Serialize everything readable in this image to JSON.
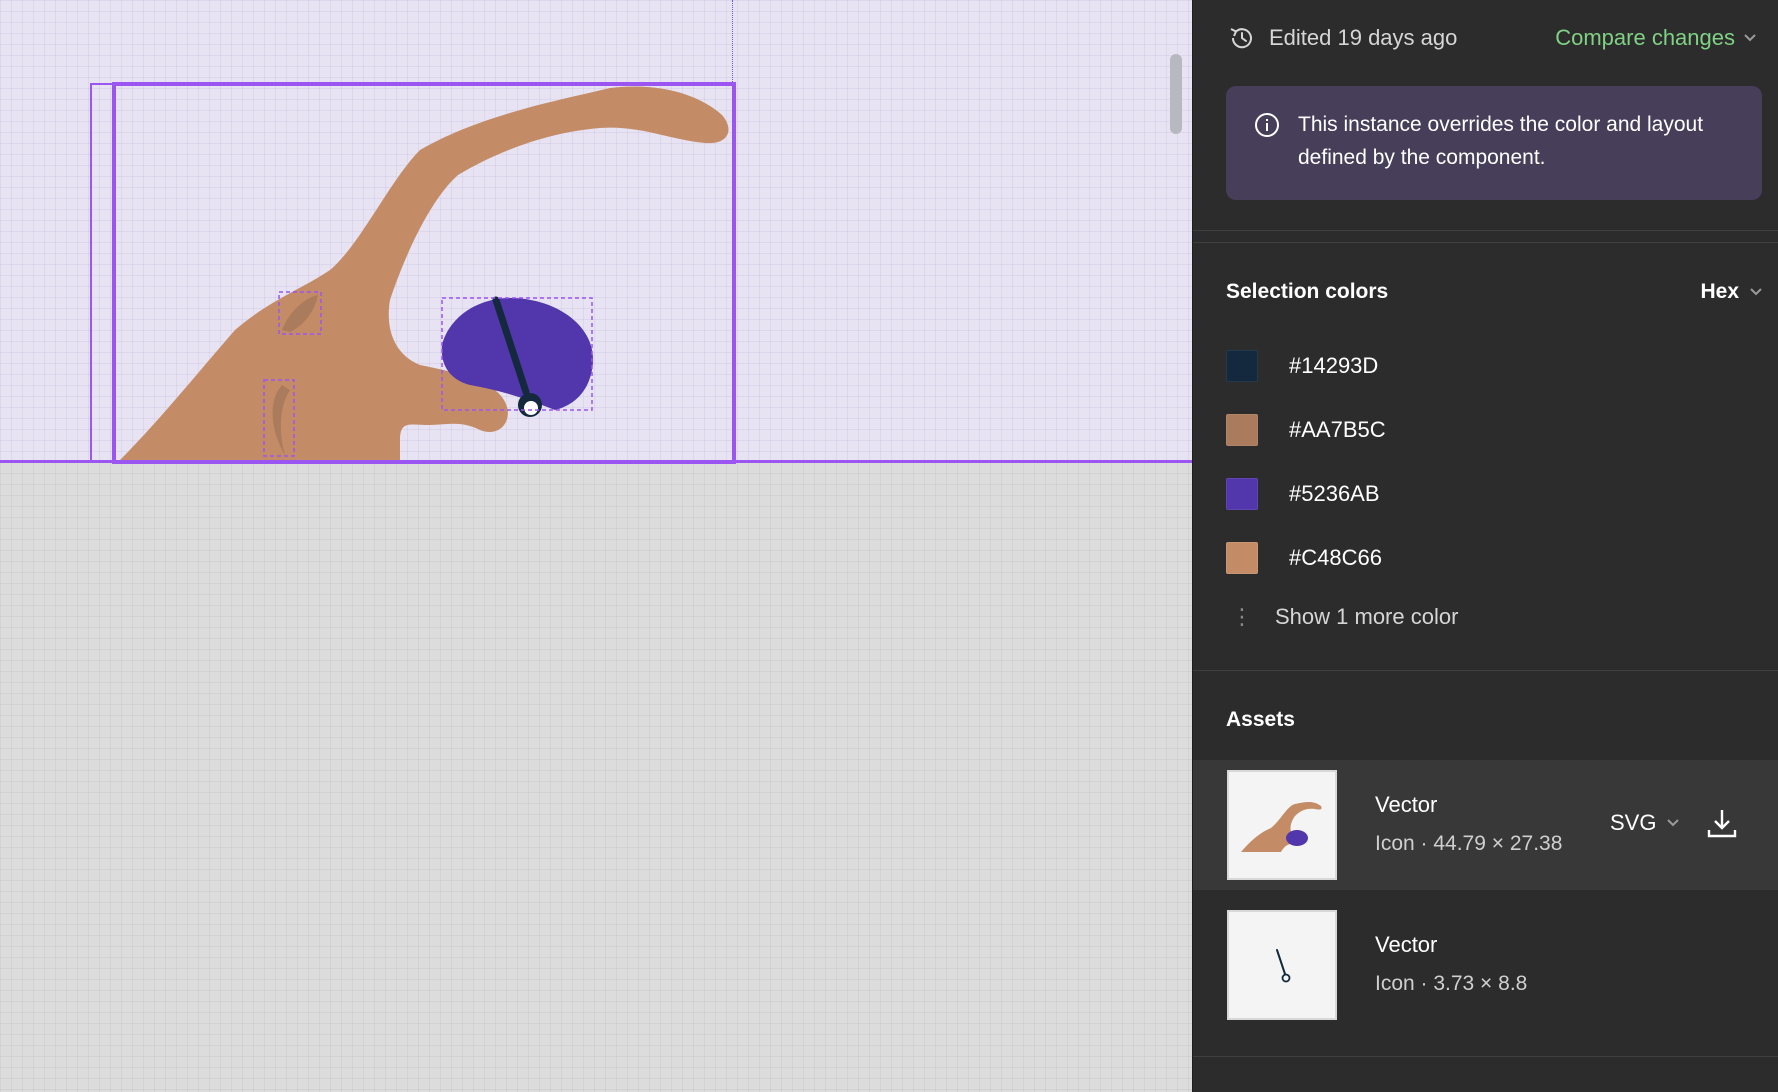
{
  "header": {
    "edited_text": "Edited 19 days ago",
    "compare_label": "Compare changes"
  },
  "notice": {
    "text": "This instance overrides the color and layout defined by the component."
  },
  "selection_colors": {
    "title": "Selection colors",
    "format": "Hex",
    "colors": [
      {
        "label": "#14293D",
        "hex": "#14293D"
      },
      {
        "label": "#AA7B5C",
        "hex": "#AA7B5C"
      },
      {
        "label": "#5236AB",
        "hex": "#5236AB"
      },
      {
        "label": "#C48C66",
        "hex": "#C48C66"
      }
    ],
    "more_label": "Show 1 more color"
  },
  "assets": {
    "title": "Assets",
    "items": [
      {
        "name": "Vector",
        "meta": "Icon · 44.79 × 27.38",
        "format": "SVG"
      },
      {
        "name": "Vector",
        "meta": "Icon · 3.73 × 8.8"
      }
    ]
  },
  "theme": {
    "accent_selection": "#9B55F0",
    "compare_green": "#7FD184",
    "skin": "#C48C66",
    "skin_shadow": "#AA7B5C",
    "cap": "#5236AB",
    "strap": "#14293D"
  }
}
